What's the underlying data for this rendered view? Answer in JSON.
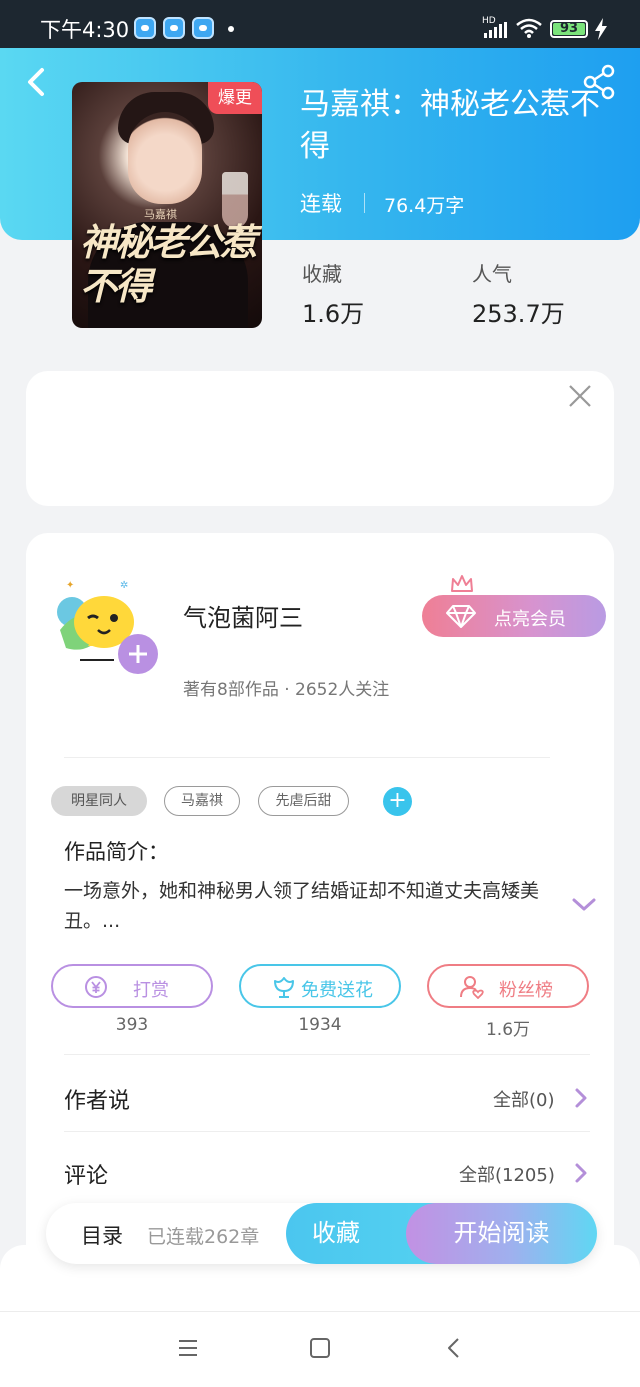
{
  "status_bar": {
    "time": "下午4:30",
    "network": "HD",
    "battery": "93"
  },
  "book": {
    "cover_badge": "爆更",
    "cover_title": "神秘老公惹不得",
    "cover_author": "马嘉祺",
    "title": "马嘉祺：神秘老公惹不得",
    "status": "连载",
    "word_count": "76.4万字",
    "stats": [
      {
        "label": "收藏",
        "value": "1.6万"
      },
      {
        "label": "人气",
        "value": "253.7万"
      }
    ]
  },
  "author": {
    "name": "气泡菌阿三",
    "meta": "著有8部作品 · 2652人关注",
    "vip_label": "点亮会员"
  },
  "tags": [
    "明星同人",
    "马嘉祺",
    "先虐后甜"
  ],
  "intro": {
    "title": "作品简介：",
    "text": "一场意外，她和神秘男人领了结婚证却不知道丈夫高矮美丑。..."
  },
  "actions": [
    {
      "label": "打赏",
      "count": "393",
      "color": "#b990e2"
    },
    {
      "label": "免费送花",
      "count": "1934",
      "color": "#49c6e8"
    },
    {
      "label": "粉丝榜",
      "count": "1.6万",
      "color": "#ef7d84"
    }
  ],
  "rows": [
    {
      "title": "作者说",
      "link": "全部(0)"
    },
    {
      "title": "评论",
      "link": "全部(1205)"
    }
  ],
  "bottom_bar": {
    "toc": "目录",
    "chapters": "已连载262章",
    "collect": "收藏",
    "read": "开始阅读"
  },
  "icons": [
    "back-icon",
    "share-icon",
    "close-icon",
    "diamond-icon",
    "crown-icon",
    "yuan-icon",
    "flower-icon",
    "fan-icon",
    "chevron-right-icon",
    "chevron-down-icon",
    "menu-icon",
    "home-icon",
    "nav-back-icon"
  ]
}
